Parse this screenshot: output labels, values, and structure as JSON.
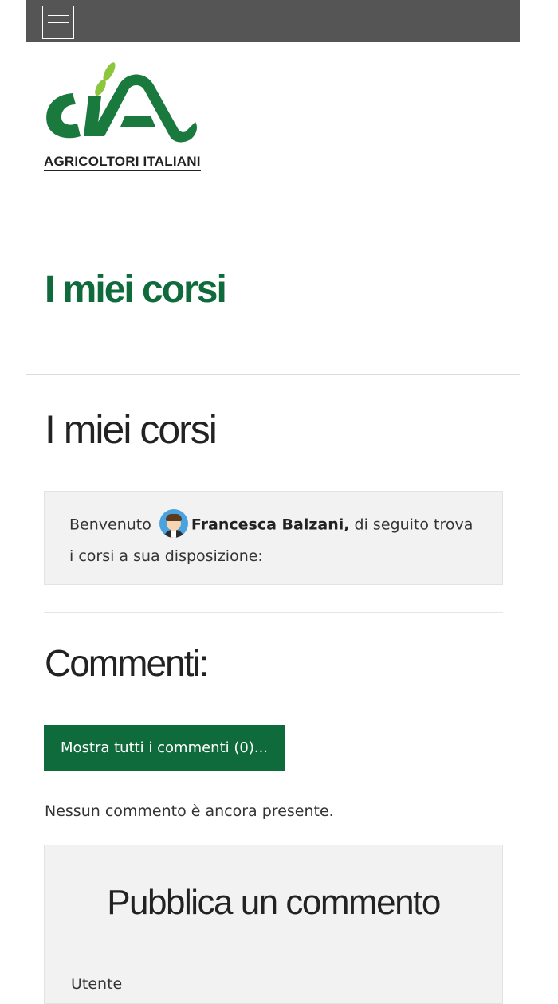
{
  "header": {
    "logo_text": "AGRICOLTORI  ITALIANI",
    "logo_mark": "cia",
    "brand_color": "#1a7a3e",
    "leaf_color": "#8cc63f"
  },
  "page": {
    "title": "I miei corsi",
    "section_title": "I miei corsi"
  },
  "welcome": {
    "prefix": "Benvenuto",
    "user_name": "Francesca Balzani,",
    "suffix": " di seguito trova i corsi a sua disposizione:"
  },
  "comments": {
    "title": "Commenti:",
    "show_all_label": "Mostra tutti i commenti (0)...",
    "empty_text": "Nessun commento è ancora presente.",
    "publish_title": "Pubblica un commento",
    "user_label": "Utente"
  },
  "colors": {
    "accent": "#0f6b3c",
    "topbar": "#555555",
    "box_bg": "#f2f2f2"
  }
}
